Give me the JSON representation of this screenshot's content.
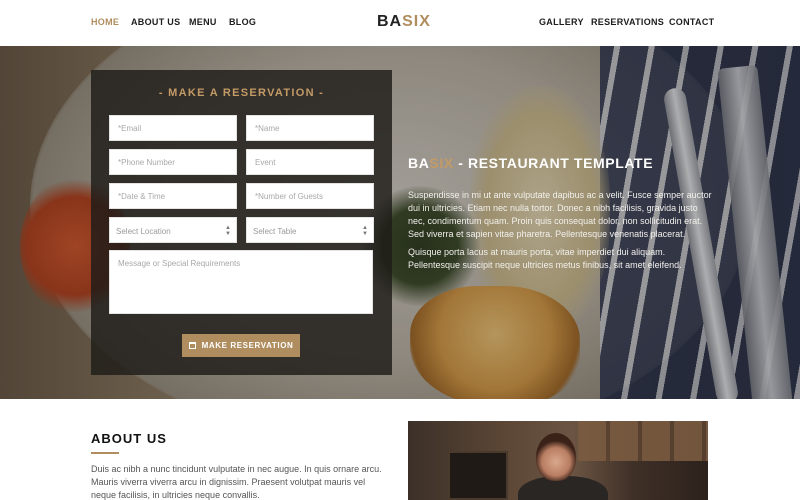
{
  "nav": {
    "left": [
      "HOME",
      "ABOUT US",
      "MENU",
      "BLOG"
    ],
    "right": [
      "GALLERY",
      "RESERVATIONS",
      "CONTACT"
    ],
    "active": "HOME",
    "logo_part1": "BA",
    "logo_part2": "SIX"
  },
  "reservation": {
    "title": "- MAKE A RESERVATION -",
    "email_placeholder": "*Email",
    "name_placeholder": "*Name",
    "phone_placeholder": "*Phone Number",
    "event_placeholder": "Event",
    "date_placeholder": "*Date & Time",
    "guests_placeholder": "*Number of Guests",
    "location_select": "Select Location",
    "table_select": "Select Table",
    "message_placeholder": "Message or Special Requirements",
    "button_label": "MAKE RESERVATION"
  },
  "hero": {
    "title_brand_a": "BA",
    "title_brand_b": "SIX",
    "title_rest": " - RESTAURANT TEMPLATE",
    "paragraph1": "Suspendisse in mi ut ante vulputate dapibus ac a velit. Fusce semper auctor dui in ultricies. Etiam nec nulla tortor. Donec a nibh facilisis, gravida justo nec, condimentum quam. Proin quis consequat dolor, non sollicitudin erat. Sed viverra et sapien vitae pharetra. Pellentesque venenatis placerat.",
    "paragraph2": "Quisque porta lacus at mauris porta, vitae imperdiet dui aliquam. Pellentesque suscipit neque ultricies metus finibus, sit amet eleifend."
  },
  "about": {
    "title": "ABOUT US",
    "paragraph": "Duis ac nibh a nunc tincidunt vulputate in nec augue. In quis ornare arcu. Mauris viverra viverra arcu in dignissim. Praesent volutpat mauris vel neque facilisis, in ultricies neque convallis."
  },
  "colors": {
    "accent": "#b08d5f",
    "panel": "#1e1c19"
  },
  "icons": {
    "button_icon": "calendar-icon"
  }
}
